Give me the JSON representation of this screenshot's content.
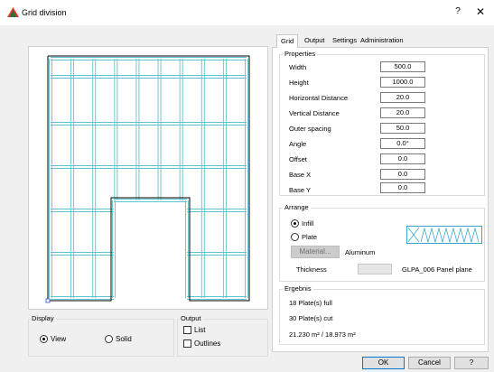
{
  "window": {
    "title": "Grid division",
    "help_glyph": "?",
    "close_glyph": "✕"
  },
  "colors": {
    "grid_line": "#62c3d0",
    "outline": "#000000",
    "accent": "#0078d7"
  },
  "display": {
    "label": "Display",
    "options": [
      {
        "label": "View",
        "selected": true
      },
      {
        "label": "Solid",
        "selected": false
      }
    ]
  },
  "output_group": {
    "label": "Output",
    "options": [
      {
        "label": "List",
        "checked": false
      },
      {
        "label": "Outlines",
        "checked": false
      }
    ]
  },
  "tabs": [
    {
      "label": "Grid",
      "active": true
    },
    {
      "label": "Output",
      "active": false
    },
    {
      "label": "Settings",
      "active": false
    },
    {
      "label": "Administration",
      "active": false
    }
  ],
  "properties": {
    "label": "Properties",
    "fields": [
      {
        "label": "Width",
        "value": "500.0"
      },
      {
        "label": "Height",
        "value": "1000.0"
      },
      {
        "label": "Horizontal Distance",
        "value": "20.0"
      },
      {
        "label": "Vertical Distance",
        "value": "20.0"
      },
      {
        "label": "Outer spacing",
        "value": "50.0"
      },
      {
        "label": "Angle",
        "value": "0.0°"
      },
      {
        "label": "Offset",
        "value": "0.0"
      },
      {
        "label": "Base X",
        "value": "0.0"
      },
      {
        "label": "Base Y",
        "value": "0.0"
      }
    ]
  },
  "arrange": {
    "label": "Arrange",
    "options": [
      {
        "label": "Infill",
        "selected": true
      },
      {
        "label": "Plate",
        "selected": false
      }
    ],
    "material_button": "Material...",
    "material_value": "Aluminum",
    "thickness_label": "Thickness",
    "thickness_value": "",
    "panel_name": "GLPA_006 Panel plane"
  },
  "result": {
    "label": "Ergebnis",
    "lines": [
      "18 Plate(s) full",
      "30 Plate(s) cut",
      "21.230 m² / 18.973 m²"
    ]
  },
  "buttons": {
    "ok": "OK",
    "cancel": "Cancel",
    "help": "?"
  }
}
